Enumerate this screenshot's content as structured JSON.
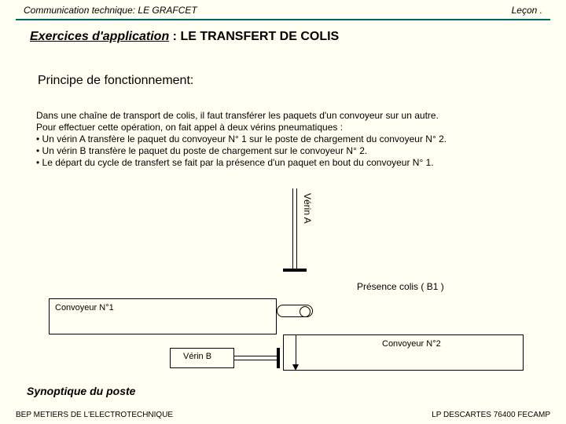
{
  "header": {
    "left": "Communication technique: LE GRAFCET",
    "right": "Leçon ."
  },
  "title": {
    "prefix": "Exercices d'application",
    "sep": " :  ",
    "main": "LE TRANSFERT DE COLIS"
  },
  "principle": "Principe de fonctionnement:",
  "body": {
    "l1": "Dans une chaîne de transport de colis, il faut transférer les paquets d'un convoyeur sur un autre.",
    "l2": "Pour effectuer cette opération, on fait appel à deux vérins pneumatiques :",
    "l3": "• Un vérin A transfère le paquet du convoyeur N° 1 sur le poste de chargement du convoyeur N° 2.",
    "l4": "• Un vérin B transfère le paquet du poste de chargement sur le convoyeur N° 2.",
    "l5": "• Le départ du cycle de transfert se fait par la présence d'un paquet en bout du convoyeur N° 1."
  },
  "diagram": {
    "verin_a": "Vérin A",
    "presence": "Présence colis ( B1 )",
    "conv1": "Convoyeur N°1",
    "verin_b": "Vérin B",
    "conv2": "Convoyeur N°2"
  },
  "synoptic": "Synoptique du poste",
  "footer": {
    "left": "BEP METIERS DE L'ELECTROTECHNIQUE",
    "right": "LP DESCARTES 76400 FECAMP"
  }
}
